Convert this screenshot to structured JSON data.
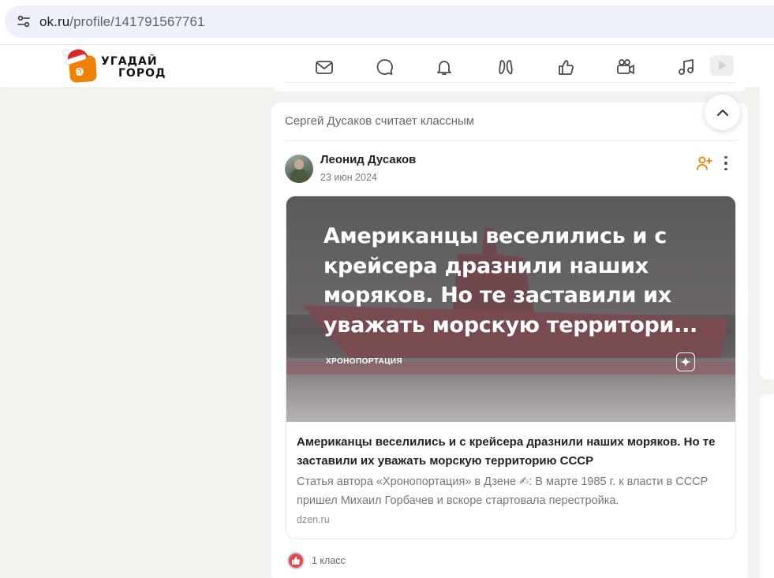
{
  "browser": {
    "url_host": "ok.ru",
    "url_path": "/profile/141791567761"
  },
  "header": {
    "logo_line1": "УГАДАЙ",
    "logo_line2": "ГОРОД",
    "nav": [
      "mail-icon",
      "chat-icon",
      "bell-icon",
      "guests-icon",
      "like-icon",
      "video-call-icon",
      "music-icon",
      "video-icon"
    ]
  },
  "feed": {
    "activity_text": "Сергей Дусаков считает классным",
    "post": {
      "author": "Леонид Дусаков",
      "date": "23 июн 2024",
      "preview_title": "Американцы веселились и с\nкрейсера дразнили наших\nморяков. Но те заставили их\nуважать морскую территори...",
      "preview_source": "ХРОНОПОРТАЦИЯ",
      "link_title": "Американцы веселились и с крейсера дразнили наших моряков. Но те заставили их уважать морскую территорию СССР",
      "link_description": "Статья автора «Хронопортация» в Дзене ✍: В марте 1985 г. к власти в СССР пришел Михаил Горбачев и вскоре стартовала перестройка.",
      "link_domain": "dzen.ru",
      "likes": "1 класс"
    }
  },
  "colors": {
    "accent": "#ee8208",
    "page_bg": "#f4f2ef",
    "like_red": "#e04a4a"
  }
}
